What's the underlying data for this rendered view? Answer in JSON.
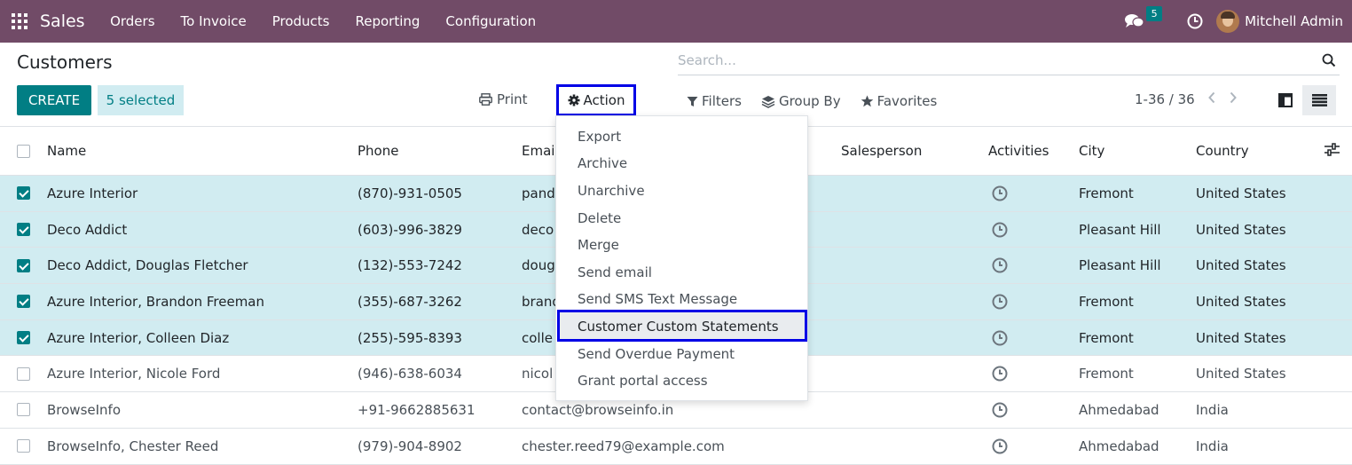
{
  "nav": {
    "app_name": "Sales",
    "menu": [
      "Orders",
      "To Invoice",
      "Products",
      "Reporting",
      "Configuration"
    ],
    "messages_count": "5",
    "user_name": "Mitchell Admin"
  },
  "control": {
    "breadcrumb": "Customers",
    "search_placeholder": "Search...",
    "create_label": "CREATE",
    "selected_label": "5 selected",
    "print_label": "Print",
    "action_label": "Action",
    "filters_label": "Filters",
    "groupby_label": "Group By",
    "favorites_label": "Favorites",
    "pager_label": "1-36 / 36"
  },
  "table": {
    "headers": [
      "Name",
      "Phone",
      "Email",
      "Salesperson",
      "Activities",
      "City",
      "Country"
    ],
    "rows": [
      {
        "selected": true,
        "name": "Azure Interior",
        "phone": "(870)-931-0505",
        "email": "pand",
        "city": "Fremont",
        "country": "United States"
      },
      {
        "selected": true,
        "name": "Deco Addict",
        "phone": "(603)-996-3829",
        "email": "deco",
        "city": "Pleasant Hill",
        "country": "United States"
      },
      {
        "selected": true,
        "name": "Deco Addict, Douglas Fletcher",
        "phone": "(132)-553-7242",
        "email": "doug",
        "city": "Pleasant Hill",
        "country": "United States"
      },
      {
        "selected": true,
        "name": "Azure Interior, Brandon Freeman",
        "phone": "(355)-687-3262",
        "email": "brand",
        "city": "Fremont",
        "country": "United States"
      },
      {
        "selected": true,
        "name": "Azure Interior, Colleen Diaz",
        "phone": "(255)-595-8393",
        "email": "colle",
        "city": "Fremont",
        "country": "United States"
      },
      {
        "selected": false,
        "name": "Azure Interior, Nicole Ford",
        "phone": "(946)-638-6034",
        "email": "nicol",
        "city": "Fremont",
        "country": "United States"
      },
      {
        "selected": false,
        "name": "BrowseInfo",
        "phone": "+91-9662885631",
        "email": "contact@browseinfo.in",
        "city": "Ahmedabad",
        "country": "India"
      },
      {
        "selected": false,
        "name": "BrowseInfo, Chester Reed",
        "phone": "(979)-904-8902",
        "email": "chester.reed79@example.com",
        "city": "Ahmedabad",
        "country": "India"
      }
    ]
  },
  "action_menu": {
    "items": [
      "Export",
      "Archive",
      "Unarchive",
      "Delete",
      "Merge",
      "Send email",
      "Send SMS Text Message",
      "Customer Custom Statements",
      "Send Overdue Payment",
      "Grant portal access"
    ],
    "highlighted": "Customer Custom Statements"
  },
  "colors": {
    "navbar": "#714b67",
    "primary": "#017e84",
    "selected_row": "#d1ecf1",
    "highlight_border": "#0000e6"
  }
}
